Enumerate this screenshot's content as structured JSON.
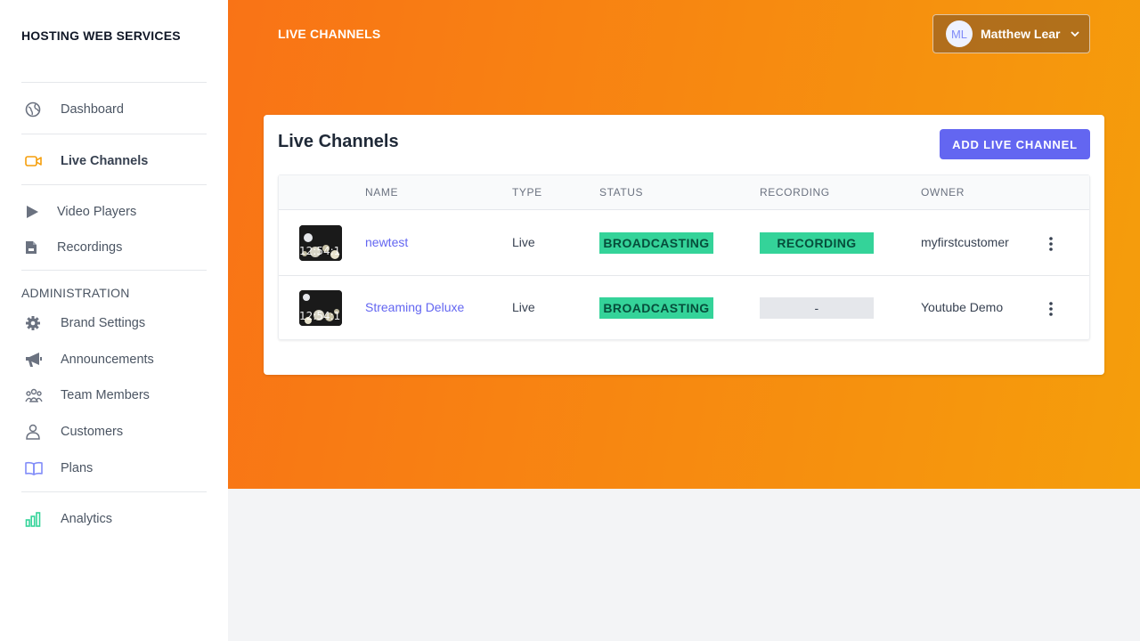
{
  "sidebar": {
    "brand": "HOSTING WEB SERVICES",
    "items": [
      {
        "label": "Dashboard",
        "icon": "globe-icon"
      },
      {
        "label": "Live Channels",
        "icon": "video-camera-icon",
        "active": true
      },
      {
        "label": "Video Players",
        "icon": "play-icon"
      },
      {
        "label": "Recordings",
        "icon": "document-icon"
      }
    ],
    "admin_title": "ADMINISTRATION",
    "admin_items": [
      {
        "label": "Brand Settings",
        "icon": "gear-icon"
      },
      {
        "label": "Announcements",
        "icon": "megaphone-icon"
      },
      {
        "label": "Team Members",
        "icon": "team-icon"
      },
      {
        "label": "Customers",
        "icon": "users-icon"
      },
      {
        "label": "Plans",
        "icon": "book-icon"
      }
    ],
    "analytics": {
      "label": "Analytics",
      "icon": "chart-bar-icon"
    }
  },
  "header": {
    "title": "LIVE CHANNELS",
    "user": {
      "initials": "ML",
      "name": "Matthew Lear"
    }
  },
  "card": {
    "title": "Live Channels",
    "add_button": "ADD LIVE CHANNEL",
    "columns": [
      "NAME",
      "TYPE",
      "STATUS",
      "RECORDING",
      "OWNER"
    ],
    "rows": [
      {
        "name": "newtest",
        "type": "Live",
        "status": "BROADCASTING",
        "recording": "RECORDING",
        "owner": "myfirstcustomer",
        "thumb_time": "12:54:1"
      },
      {
        "name": "Streaming Deluxe",
        "type": "Live",
        "status": "BROADCASTING",
        "recording": "-",
        "owner": "Youtube Demo",
        "thumb_time": "12:54:1"
      }
    ]
  },
  "colors": {
    "accent": "#6366f1",
    "header_start": "#f97316",
    "header_end": "#f59e0b",
    "badge_green": "#34d399",
    "badge_gray": "#e5e7eb"
  }
}
